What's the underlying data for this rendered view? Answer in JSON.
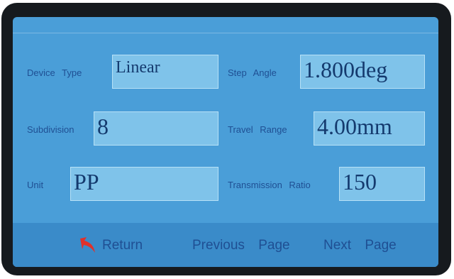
{
  "fields": {
    "device_type": {
      "label": "Device Type",
      "value": "Linear"
    },
    "step_angle": {
      "label": "Step Angle",
      "value": "1.800deg"
    },
    "subdivision": {
      "label": "Subdivision",
      "value": "8"
    },
    "travel_range": {
      "label": "Travel Range",
      "value": "4.00mm"
    },
    "unit": {
      "label": "Unit",
      "value": "PP"
    },
    "transmission_ratio": {
      "label": "Transmission Ratio",
      "value": "150"
    }
  },
  "nav": {
    "return_label": "Return",
    "previous_label": "Previous Page",
    "next_label": "Next Page"
  },
  "icons": {
    "return": "return-arrow-icon"
  },
  "colors": {
    "screen_bg": "#4a9ed8",
    "field_bg": "#7fc3ea",
    "label_text": "#1f4f93",
    "return_icon": "#e0312b"
  }
}
